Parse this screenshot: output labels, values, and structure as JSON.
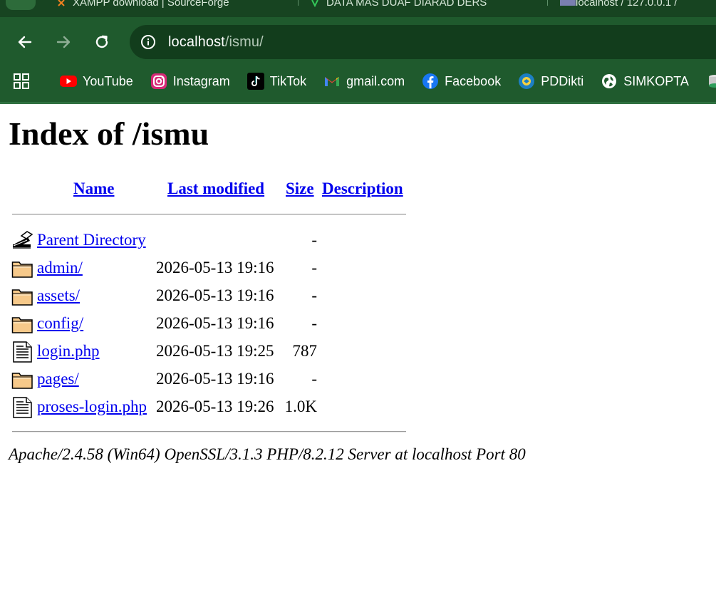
{
  "tabs": [
    {
      "label": "XAMPP download | SourceForge"
    },
    {
      "label": "DATA MAS DUAF DIARAD DERS"
    },
    {
      "label": "localhost / 127.0.0.1 / "
    }
  ],
  "nav": {
    "url_host": "localhost",
    "url_path": "/ismu/"
  },
  "bookmarks": [
    {
      "label": "YouTube",
      "icon": "youtube-icon"
    },
    {
      "label": "Instagram",
      "icon": "instagram-icon"
    },
    {
      "label": "TikTok",
      "icon": "tiktok-icon"
    },
    {
      "label": "gmail.com",
      "icon": "gmail-icon"
    },
    {
      "label": "Facebook",
      "icon": "facebook-icon"
    },
    {
      "label": "PDDikti",
      "icon": "pddikti-icon"
    },
    {
      "label": "SIMKOPTA",
      "icon": "globe-icon"
    }
  ],
  "page": {
    "title": "Index of /ismu",
    "columns": {
      "name": "Name",
      "last_modified": "Last modified",
      "size": "Size",
      "description": "Description"
    },
    "rows": [
      {
        "name": "Parent Directory",
        "date": "",
        "size": "-",
        "icon": "back-icon"
      },
      {
        "name": "admin/",
        "date": "2026-05-13 19:16",
        "size": "-",
        "icon": "folder-icon"
      },
      {
        "name": "assets/",
        "date": "2026-05-13 19:16",
        "size": "-",
        "icon": "folder-icon"
      },
      {
        "name": "config/",
        "date": "2026-05-13 19:16",
        "size": "-",
        "icon": "folder-icon"
      },
      {
        "name": "login.php",
        "date": "2026-05-13 19:25",
        "size": "787",
        "icon": "text-file-icon"
      },
      {
        "name": "pages/",
        "date": "2026-05-13 19:16",
        "size": "-",
        "icon": "folder-icon"
      },
      {
        "name": "proses-login.php",
        "date": "2026-05-13 19:26",
        "size": "1.0K",
        "icon": "text-file-icon"
      }
    ],
    "footer": "Apache/2.4.58 (Win64) OpenSSL/3.1.3 PHP/8.2.12 Server at localhost Port 80"
  },
  "colors": {
    "chrome_bg": "#1f5a2d",
    "omnibox_bg": "#123d1c",
    "link": "#0000ee",
    "folder_fill": "#f6c98a"
  }
}
